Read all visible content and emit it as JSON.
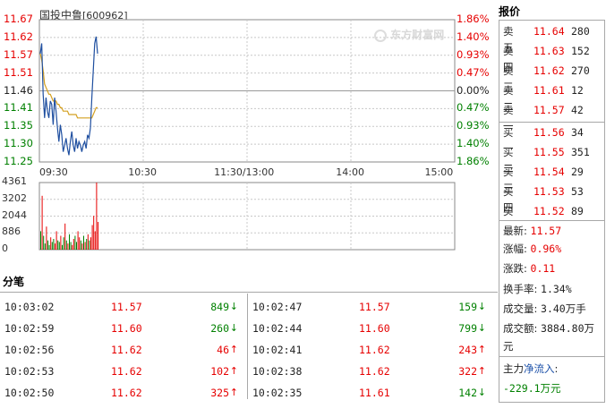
{
  "stock": {
    "name": "国投中鲁",
    "code": "[600962]"
  },
  "watermark": "东方财富网",
  "price_axis": {
    "left": [
      "11.67",
      "11.62",
      "11.57",
      "11.51",
      "11.46",
      "11.41",
      "11.35",
      "11.30",
      "11.25"
    ],
    "right": [
      "1.86%",
      "1.40%",
      "0.93%",
      "0.47%",
      "0.00%",
      "0.47%",
      "0.93%",
      "1.40%",
      "1.86%"
    ],
    "time": [
      "09:30",
      "10:30",
      "11:30/13:00",
      "14:00",
      "15:00"
    ]
  },
  "volume_axis": {
    "labels": [
      "4361",
      "3202",
      "2044",
      "886",
      "0"
    ]
  },
  "colors": {
    "up": "#e60000",
    "down": "#008000",
    "price_line": "#1f4fa0",
    "avg_line": "#d4a020",
    "grid": "#c8c8c8"
  },
  "report": {
    "title": "报价",
    "asks": [
      {
        "label": "卖五",
        "price": "11.64",
        "vol": "280"
      },
      {
        "label": "卖四",
        "price": "11.63",
        "vol": "152"
      },
      {
        "label": "卖三",
        "price": "11.62",
        "vol": "270"
      },
      {
        "label": "卖二",
        "price": "11.61",
        "vol": "12"
      },
      {
        "label": "卖一",
        "price": "11.57",
        "vol": "42"
      }
    ],
    "bids": [
      {
        "label": "买一",
        "price": "11.56",
        "vol": "34"
      },
      {
        "label": "买二",
        "price": "11.55",
        "vol": "351"
      },
      {
        "label": "买三",
        "price": "11.54",
        "vol": "29"
      },
      {
        "label": "买四",
        "price": "11.53",
        "vol": "53"
      },
      {
        "label": "买五",
        "price": "11.52",
        "vol": "89"
      }
    ],
    "stats": {
      "latest_label": "最新:",
      "latest": "11.57",
      "change_pct_label": "涨幅:",
      "change_pct": "0.96%",
      "change_label": "涨跌:",
      "change": "0.11",
      "turnover_label": "换手率:",
      "turnover": "1.34%",
      "volume_label": "成交量:",
      "volume": "3.40万手",
      "amount_label": "成交额:",
      "amount": "3884.80万",
      "amount_unit": "元",
      "mainflow_label": "主力",
      "mainflow_link": "净流入",
      "mainflow_colon": ":",
      "mainflow_value": "-229.1万元"
    }
  },
  "ticks": {
    "title": "分笔",
    "left": [
      {
        "time": "10:03:02",
        "price": "11.57",
        "vol": "849",
        "dir": "down"
      },
      {
        "time": "10:02:59",
        "price": "11.60",
        "vol": "260",
        "dir": "down"
      },
      {
        "time": "10:02:56",
        "price": "11.62",
        "vol": "46",
        "dir": "up"
      },
      {
        "time": "10:02:53",
        "price": "11.62",
        "vol": "102",
        "dir": "up"
      },
      {
        "time": "10:02:50",
        "price": "11.62",
        "vol": "325",
        "dir": "up"
      }
    ],
    "right": [
      {
        "time": "10:02:47",
        "price": "11.57",
        "vol": "159",
        "dir": "down"
      },
      {
        "time": "10:02:44",
        "price": "11.60",
        "vol": "799",
        "dir": "down"
      },
      {
        "time": "10:02:41",
        "price": "11.62",
        "vol": "243",
        "dir": "up"
      },
      {
        "time": "10:02:38",
        "price": "11.62",
        "vol": "322",
        "dir": "up"
      },
      {
        "time": "10:02:35",
        "price": "11.61",
        "vol": "142",
        "dir": "down"
      }
    ]
  },
  "chart_data": {
    "type": "line",
    "time_labels": [
      "09:30",
      "10:30",
      "11:30/13:00",
      "14:00",
      "15:00"
    ],
    "ylim": [
      11.25,
      11.67
    ],
    "series": [
      {
        "values": [
          11.57,
          11.6,
          11.45,
          11.38,
          11.44,
          11.4,
          11.38,
          11.43,
          11.42,
          11.36,
          11.44,
          11.4,
          11.35,
          11.31,
          11.36,
          11.33,
          11.28,
          11.3,
          11.32,
          11.29,
          11.27,
          11.31,
          11.34,
          11.3,
          11.28,
          11.32,
          11.29,
          11.31,
          11.3,
          11.28,
          11.3,
          11.31,
          11.29,
          11.33,
          11.32,
          11.35,
          11.44,
          11.52,
          11.6,
          11.62,
          11.57
        ]
      },
      {
        "values": [
          11.57,
          11.55,
          11.52,
          11.48,
          11.47,
          11.46,
          11.45,
          11.45,
          11.44,
          11.43,
          11.43,
          11.43,
          11.42,
          11.42,
          11.41,
          11.41,
          11.4,
          11.4,
          11.4,
          11.4,
          11.39,
          11.39,
          11.39,
          11.39,
          11.39,
          11.39,
          11.38,
          11.38,
          11.38,
          11.38,
          11.38,
          11.38,
          11.38,
          11.38,
          11.38,
          11.38,
          11.38,
          11.39,
          11.4,
          11.41,
          11.41
        ]
      }
    ],
    "volume": {
      "ylim": [
        0,
        4361
      ],
      "values": [
        1200,
        3500,
        900,
        400,
        1500,
        600,
        300,
        800,
        500,
        700,
        400,
        1200,
        600,
        500,
        900,
        300,
        800,
        1700,
        600,
        400,
        1000,
        500,
        300,
        700,
        900,
        500,
        1200,
        800,
        600,
        400,
        900,
        500,
        700,
        1000,
        600,
        800,
        1600,
        2200,
        1200,
        4361,
        1800
      ],
      "dirs": [
        "d",
        "u",
        "d",
        "d",
        "u",
        "d",
        "d",
        "u",
        "d",
        "d",
        "u",
        "u",
        "d",
        "d",
        "u",
        "d",
        "d",
        "u",
        "d",
        "u",
        "d",
        "d",
        "u",
        "u",
        "d",
        "d",
        "u",
        "u",
        "d",
        "u",
        "d",
        "u",
        "d",
        "u",
        "d",
        "u",
        "u",
        "u",
        "u",
        "u",
        "u"
      ]
    }
  }
}
